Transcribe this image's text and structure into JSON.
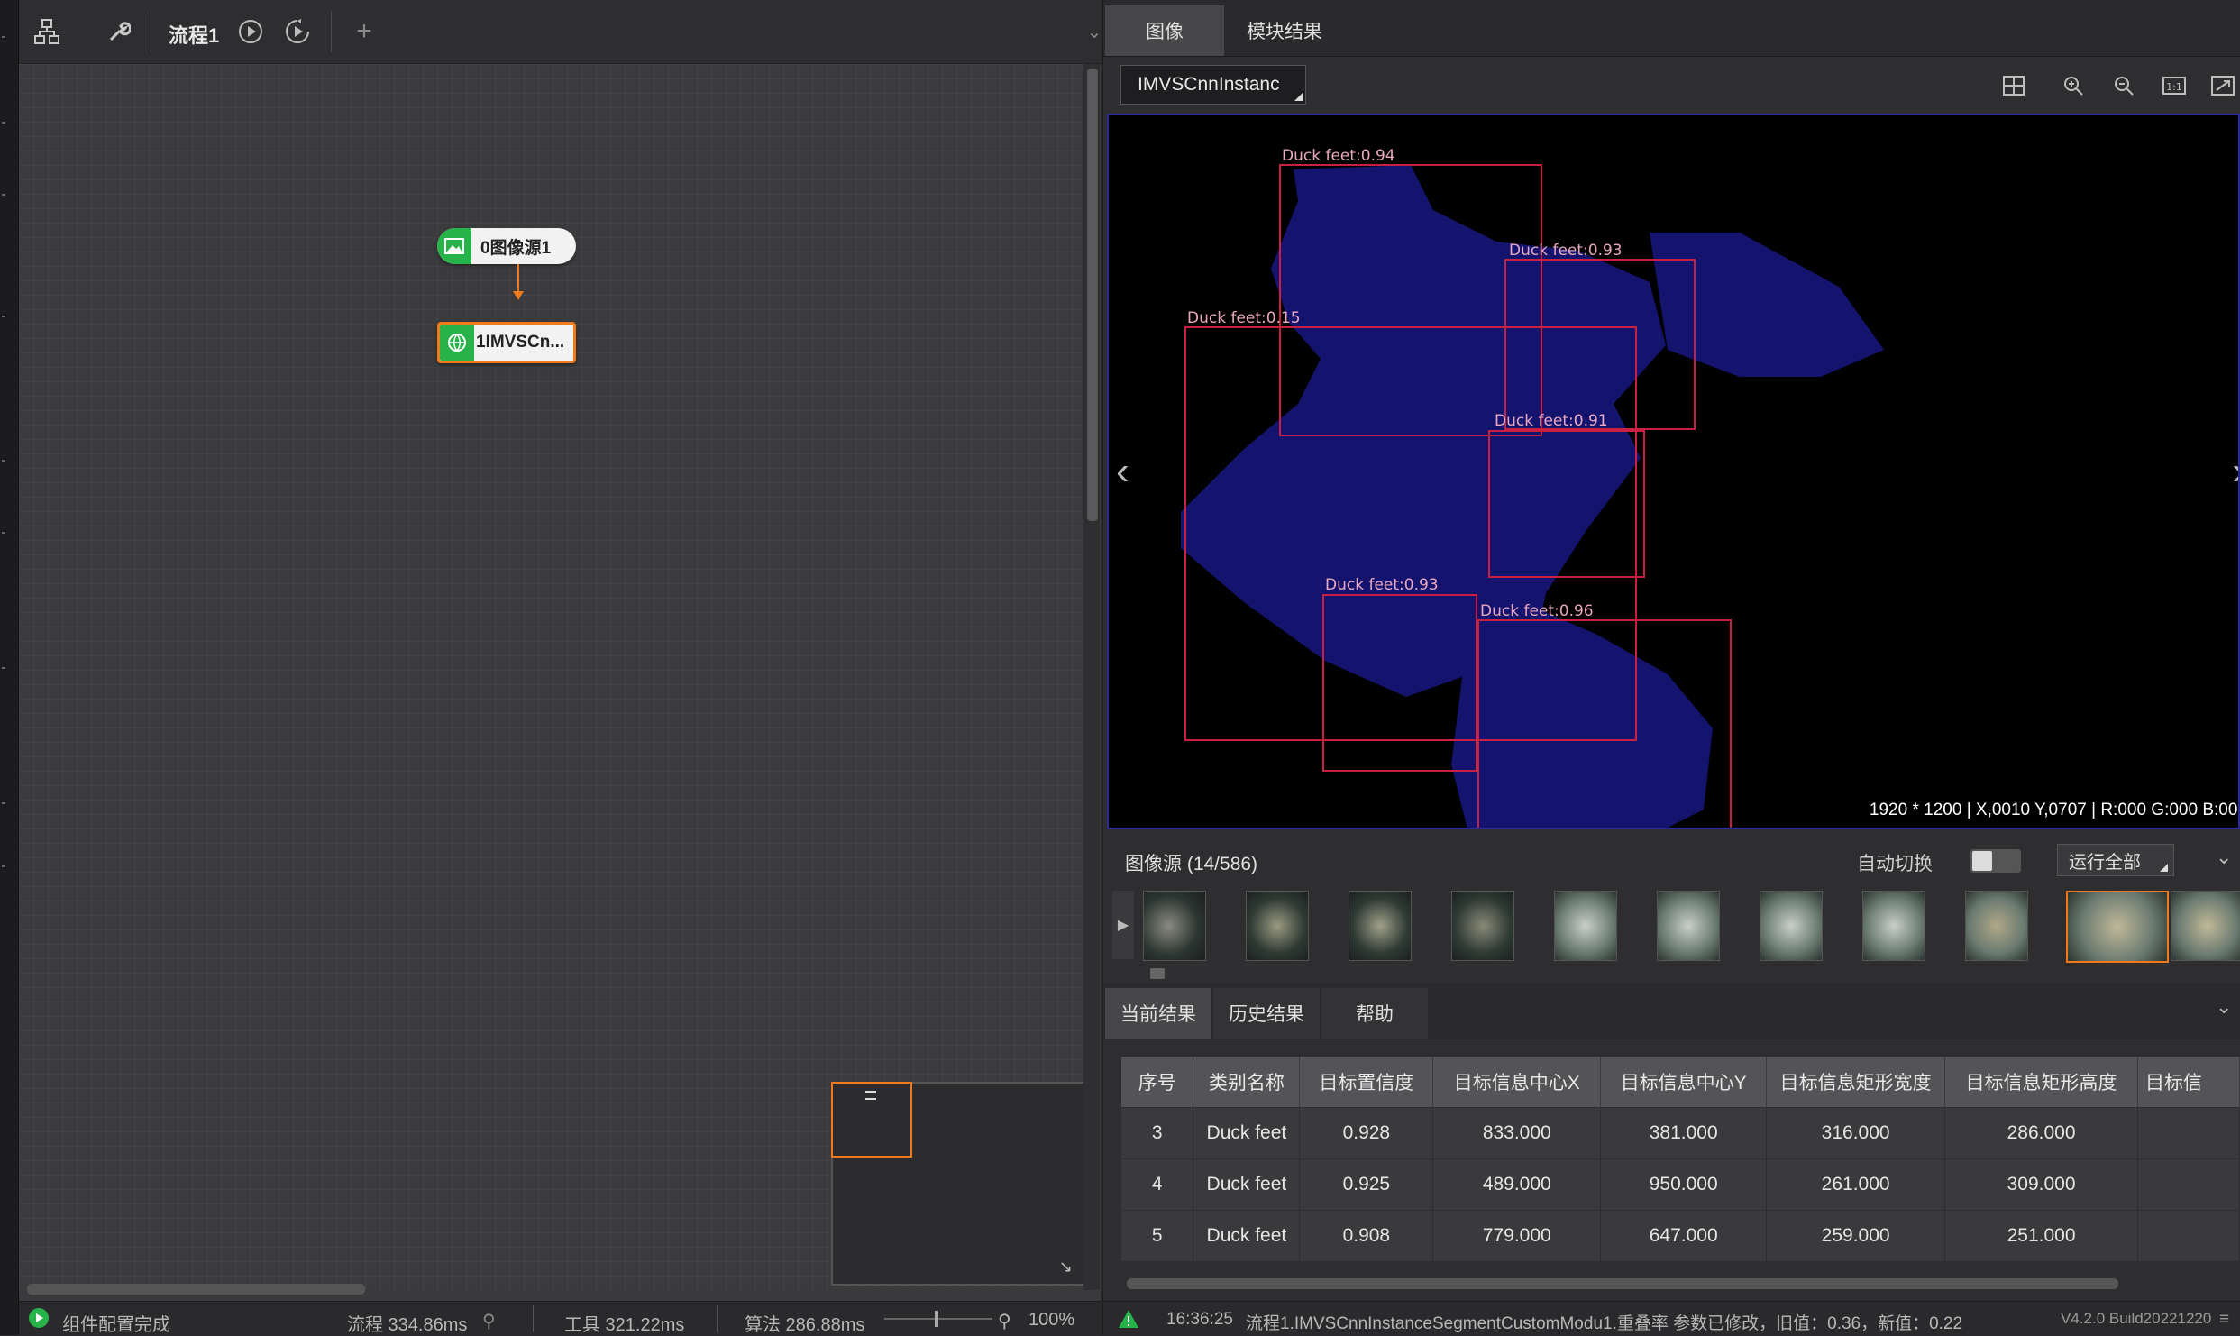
{
  "left_toolbar": {
    "flow_title": "流程1"
  },
  "nodes": {
    "source": "0图像源1",
    "module": "1IMVSCn..."
  },
  "status": {
    "message": "组件配置完成",
    "flow_time": "流程  334.86ms",
    "tool_time": "工具  321.22ms",
    "algo_time": "算法  286.88ms",
    "zoom": "100%"
  },
  "image_tabs": [
    "图像",
    "模块结果"
  ],
  "image_selector": "IMVSCnnInstanc",
  "detections": [
    {
      "label": "Duck feet:0.94"
    },
    {
      "label": "Duck feet:0.93"
    },
    {
      "label": "Duck feet:0.15"
    },
    {
      "label": "Duck feet:0.91"
    },
    {
      "label": "Duck feet:0.93"
    },
    {
      "label": "Duck feet:0.96"
    }
  ],
  "image_readout": "1920 * 1200   | X,0010  Y,0707  | R:000  G:000  B:000",
  "image_source": {
    "title": "图像源 (14/586)",
    "auto_switch": "自动切换",
    "run_all": "运行全部"
  },
  "result_tabs": [
    "当前结果",
    "历史结果",
    "帮助"
  ],
  "table": {
    "headers": [
      "序号",
      "类别名称",
      "目标置信度",
      "目标信息中心X",
      "目标信息中心Y",
      "目标信息矩形宽度",
      "目标信息矩形高度",
      "目标信"
    ],
    "rows": [
      [
        "3",
        "Duck feet",
        "0.928",
        "833.000",
        "381.000",
        "316.000",
        "286.000",
        ""
      ],
      [
        "4",
        "Duck feet",
        "0.925",
        "489.000",
        "950.000",
        "261.000",
        "309.000",
        ""
      ],
      [
        "5",
        "Duck feet",
        "0.908",
        "779.000",
        "647.000",
        "259.000",
        "251.000",
        ""
      ]
    ]
  },
  "log": {
    "time": "16:36:25",
    "message": "流程1.IMVSCnnInstanceSegmentCustomModu1.重叠率 参数已修改，旧值：0.36，新值：0.22",
    "version": "V4.2.0 Build20221220"
  }
}
